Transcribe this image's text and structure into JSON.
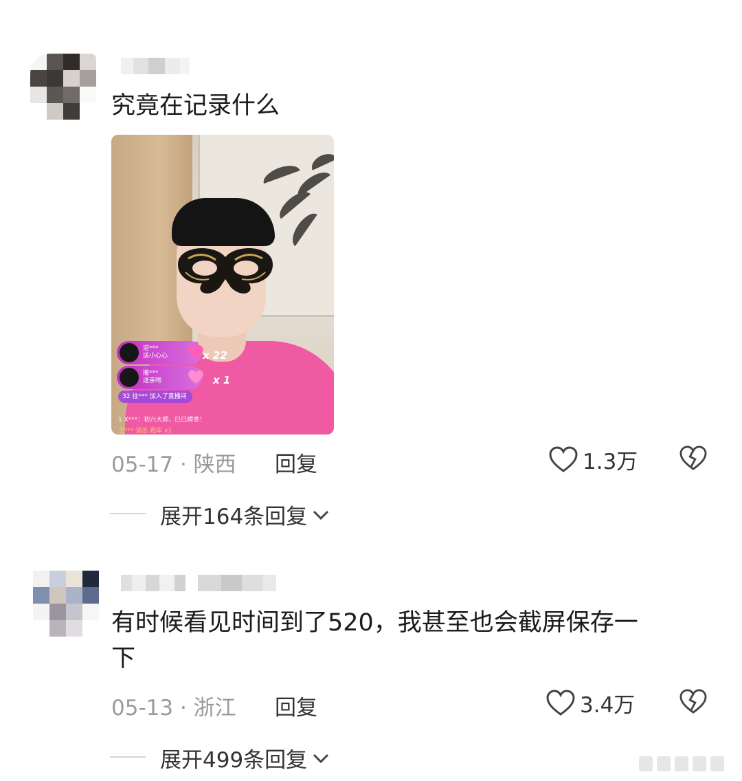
{
  "comments": [
    {
      "text": "究竟在记录什么",
      "date": "05-17",
      "location": "陕西",
      "reply_label": "回复",
      "likes": "1.3万",
      "expand_label": "展开164条回复",
      "image": {
        "gifts": [
          {
            "user": "迎***",
            "action": "送小心心",
            "count": "x 22"
          },
          {
            "user": "撒***",
            "action": "送亲吻",
            "count": "x 1"
          }
        ],
        "join_badge": "32",
        "join_text": "往*** 加入了直播间",
        "chat_lines": [
          "X***：初六大顺，巳巳顺意！",
          "王*** 送出 跑车 x1"
        ],
        "chat_badge": "1"
      }
    },
    {
      "text_line1": "有时候看见时间到了520，我甚至也会截屏保存一",
      "text_line2": "下",
      "date": "05-13",
      "location": "浙江",
      "reply_label": "回复",
      "likes": "3.4万",
      "expand_label": "展开499条回复"
    }
  ],
  "separator": "·",
  "colors": {
    "meta": "#9a9a9a",
    "text": "#1b1b1b",
    "gift_bar": "#c12fbf",
    "shirt": "#ef5aa3"
  },
  "icons": [
    "heart-outline-icon",
    "broken-heart-icon",
    "chevron-down-icon"
  ]
}
